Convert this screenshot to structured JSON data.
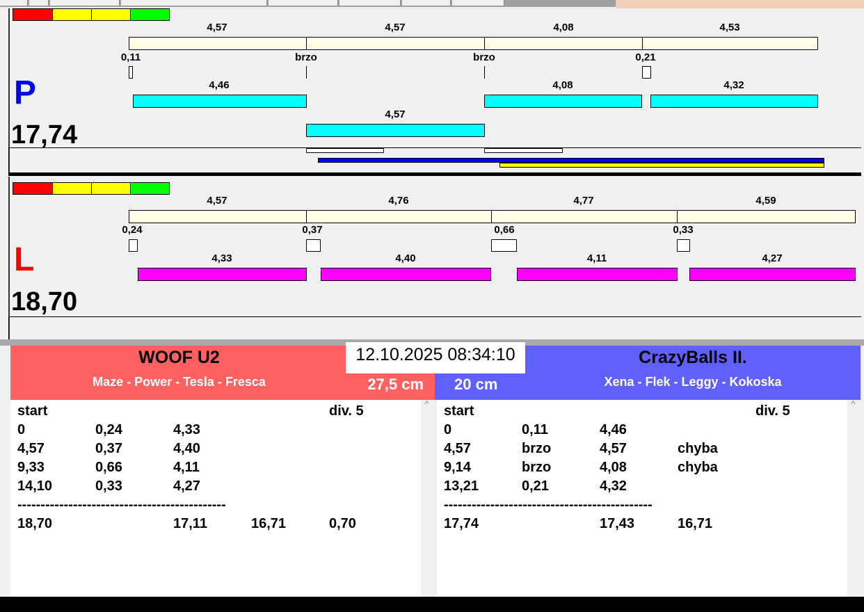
{
  "colors": {
    "red": "#ff0000",
    "yellow": "#ffff00",
    "green": "#00ff00",
    "cyan": "#00ffff",
    "magenta": "#ff00ff",
    "team_left": "#ff6060",
    "team_right": "#6060ff"
  },
  "p_panel": {
    "letter": "P",
    "total": "17,74",
    "top_labels": [
      "4,57",
      "4,57",
      "4,08",
      "4,53"
    ],
    "reaction_labels": [
      "0,11",
      "brzo",
      "brzo",
      "0,21"
    ],
    "cyan_row1": [
      "4,46",
      "4,08",
      "4,32"
    ],
    "cyan_row2": [
      "4,57"
    ]
  },
  "l_panel": {
    "letter": "L",
    "total": "18,70",
    "top_labels": [
      "4,57",
      "4,76",
      "4,77",
      "4,59"
    ],
    "reaction_labels": [
      "0,24",
      "0,37",
      "0,66",
      "0,33"
    ],
    "magenta_row": [
      "4,33",
      "4,40",
      "4,11",
      "4,27"
    ]
  },
  "datetime": "12.10.2025 08:34:10",
  "left_team": {
    "name": "WOOF U2",
    "dogs": "Maze - Power - Tesla - Fresca",
    "height": "27,5 cm",
    "header": [
      "start",
      "div.  5"
    ],
    "rows": [
      [
        "0",
        "0,24",
        "4,33",
        ""
      ],
      [
        "4,57",
        "0,37",
        "4,40",
        ""
      ],
      [
        "9,33",
        "0,66",
        "4,11",
        ""
      ],
      [
        "14,10",
        "0,33",
        "4,27",
        ""
      ]
    ],
    "separator": "---------------------------------------------",
    "totals": [
      "18,70",
      "",
      "17,11",
      "16,71",
      "0,70"
    ]
  },
  "right_team": {
    "name": "CrazyBalls II.",
    "dogs": "Xena - Flek - Leggy - Kokoska",
    "height": "20 cm",
    "header": [
      "start",
      "div.  5"
    ],
    "rows": [
      [
        "0",
        "0,11",
        "4,46",
        ""
      ],
      [
        "4,57",
        "brzo",
        "4,57",
        "chyba"
      ],
      [
        "9,14",
        "brzo",
        "4,08",
        "chyba"
      ],
      [
        "13,21",
        "0,21",
        "4,32",
        ""
      ]
    ],
    "separator": "---------------------------------------------",
    "totals": [
      "17,74",
      "",
      "17,43",
      "16,71",
      ""
    ]
  }
}
